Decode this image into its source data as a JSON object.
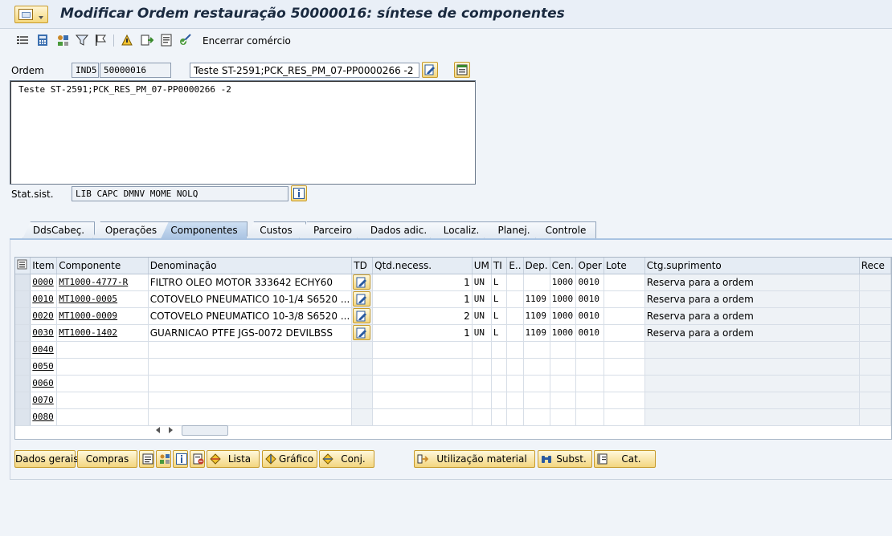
{
  "window": {
    "title": "Modificar Ordem restauração 50000016: síntese de componentes"
  },
  "toolbar": {
    "close_commerce_label": "Encerrar comércio"
  },
  "header": {
    "order_label": "Ordem",
    "order_type": "IND5",
    "order_number": "50000016",
    "order_description": "Teste ST-2591;PCK_RES_PM_07-PP0000266 -2",
    "long_text": "Teste ST-2591;PCK_RES_PM_07-PP0000266 -2",
    "status_label": "Stat.sist.",
    "status_value": "LIB  CAPC DMNV MOME NOLQ"
  },
  "tabs": [
    {
      "label": "DdsCabeç.",
      "active": false
    },
    {
      "label": "Operações",
      "active": false
    },
    {
      "label": "Componentes",
      "active": true
    },
    {
      "label": "Custos",
      "active": false
    },
    {
      "label": "Parceiro",
      "active": false
    },
    {
      "label": "Dados adic.",
      "active": false
    },
    {
      "label": "Localiz.",
      "active": false
    },
    {
      "label": "Planej.",
      "active": false
    },
    {
      "label": "Controle",
      "active": false
    }
  ],
  "grid": {
    "columns": [
      "Item",
      "Componente",
      "Denominação",
      "TD",
      "Qtd.necess.",
      "UM",
      "TI",
      "E..",
      "Dep.",
      "Cen.",
      "Oper",
      "Lote",
      "Ctg.suprimento",
      "Rece"
    ],
    "rows": [
      {
        "item": "0000",
        "component": "MT1000-4777-R",
        "description": "FILTRO OLEO MOTOR 333642 ECHY60",
        "qty": "1",
        "um": "UN",
        "ti": "L",
        "e": "",
        "dep": "",
        "cen": "1000",
        "oper": "0010",
        "lote": "",
        "supply": "Reserva para a ordem"
      },
      {
        "item": "0010",
        "component": "MT1000-0005",
        "description": "COTOVELO PNEUMATICO 10-1/4 S6520 ...",
        "qty": "1",
        "um": "UN",
        "ti": "L",
        "e": "",
        "dep": "1109",
        "cen": "1000",
        "oper": "0010",
        "lote": "",
        "supply": "Reserva para a ordem"
      },
      {
        "item": "0020",
        "component": "MT1000-0009",
        "description": "COTOVELO PNEUMATICO 10-3/8 S6520 ...",
        "qty": "2",
        "um": "UN",
        "ti": "L",
        "e": "",
        "dep": "1109",
        "cen": "1000",
        "oper": "0010",
        "lote": "",
        "supply": "Reserva para a ordem"
      },
      {
        "item": "0030",
        "component": "MT1000-1402",
        "description": "GUARNICAO PTFE JGS-0072 DEVILBSS",
        "qty": "1",
        "um": "UN",
        "ti": "L",
        "e": "",
        "dep": "1109",
        "cen": "1000",
        "oper": "0010",
        "lote": "",
        "supply": "Reserva para a ordem"
      },
      {
        "item": "0040"
      },
      {
        "item": "0050"
      },
      {
        "item": "0060"
      },
      {
        "item": "0070"
      },
      {
        "item": "0080"
      }
    ]
  },
  "buttons": {
    "general_data": "Dados gerais",
    "purchasing": "Compras",
    "list": "Lista",
    "graphic": "Gráfico",
    "set": "Conj.",
    "material_usage": "Utilização material",
    "substitute": "Subst.",
    "catalog": "Cat."
  }
}
